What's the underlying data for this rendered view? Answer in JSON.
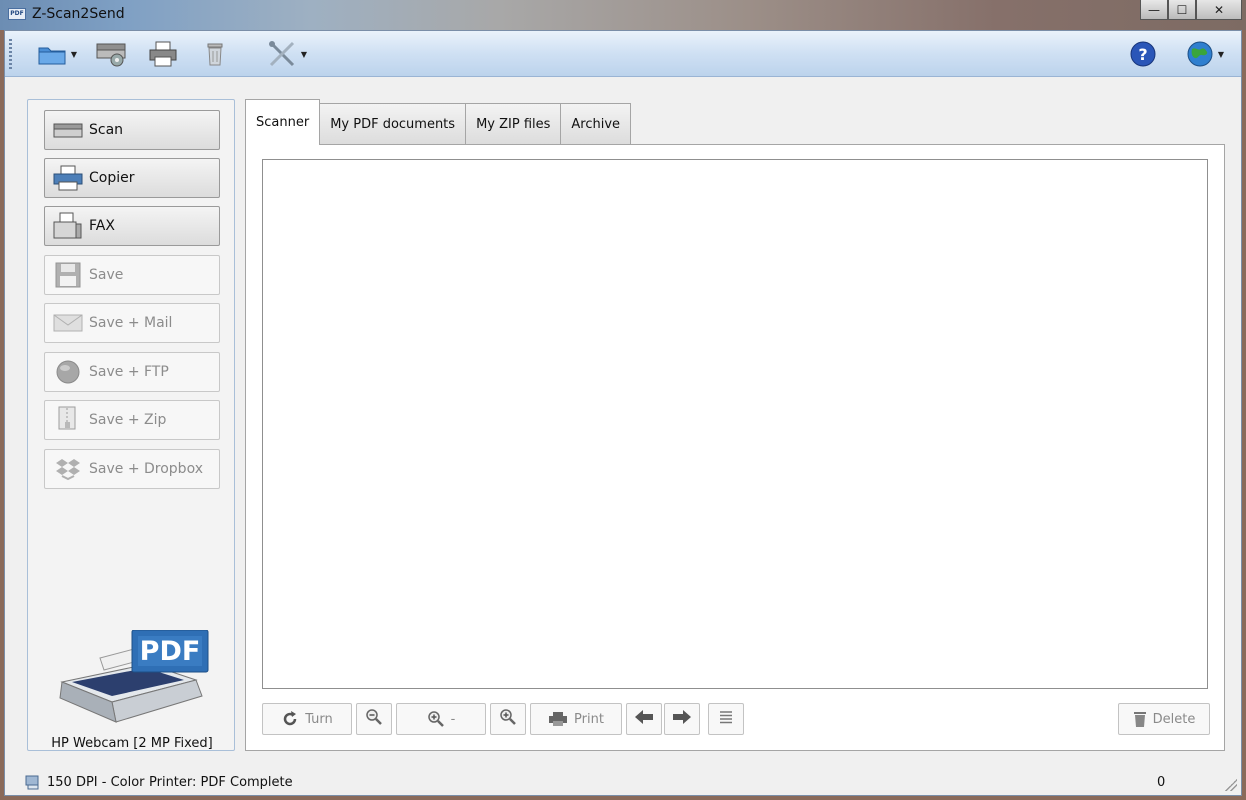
{
  "window": {
    "title": "Z-Scan2Send",
    "app_icon_text": "PDF",
    "controls": {
      "minimize": "—",
      "maximize": "☐",
      "close": "✕"
    }
  },
  "toolbar": {
    "items": [
      {
        "name": "open-folder-icon",
        "has_dropdown": true
      },
      {
        "name": "scanner-settings-icon",
        "has_dropdown": false
      },
      {
        "name": "printer-icon",
        "has_dropdown": false
      },
      {
        "name": "trash-icon",
        "has_dropdown": false
      },
      {
        "name": "tools-icon",
        "has_dropdown": true
      }
    ],
    "right_items": [
      {
        "name": "help-icon"
      },
      {
        "name": "globe-icon",
        "has_dropdown": true
      }
    ],
    "dropdown_glyph": "▼"
  },
  "actions": [
    {
      "label": "Scan",
      "enabled": true,
      "icon": "scanner-icon"
    },
    {
      "label": "Copier",
      "enabled": true,
      "icon": "copier-icon"
    },
    {
      "label": "FAX",
      "enabled": true,
      "icon": "fax-icon"
    },
    {
      "label": "Save",
      "enabled": false,
      "icon": "floppy-icon"
    },
    {
      "label": "Save + Mail",
      "enabled": false,
      "icon": "mail-icon"
    },
    {
      "label": "Save + FTP",
      "enabled": false,
      "icon": "ftp-globe-icon"
    },
    {
      "label": "Save + Zip",
      "enabled": false,
      "icon": "zip-icon"
    },
    {
      "label": "Save + Dropbox",
      "enabled": false,
      "icon": "dropbox-icon"
    }
  ],
  "device": {
    "badge": "PDF",
    "label": "HP Webcam [2 MP Fixed]"
  },
  "tabs": [
    {
      "label": "Scanner",
      "active": true
    },
    {
      "label": "My PDF documents",
      "active": false
    },
    {
      "label": "My ZIP files",
      "active": false
    },
    {
      "label": "Archive",
      "active": false
    }
  ],
  "bottom_bar": {
    "turn_label": "Turn",
    "zoom_value": "-",
    "print_label": "Print",
    "delete_label": "Delete"
  },
  "status": {
    "dpi": "150 DPI - Color",
    "printer": "Printer: PDF Complete",
    "count": "0"
  },
  "colors": {
    "toolbar_top": "#eaf2fb",
    "toolbar_bottom": "#bcd3ec",
    "pdf_badge": "#2f6fb5",
    "help_icon": "#2a56b8"
  }
}
